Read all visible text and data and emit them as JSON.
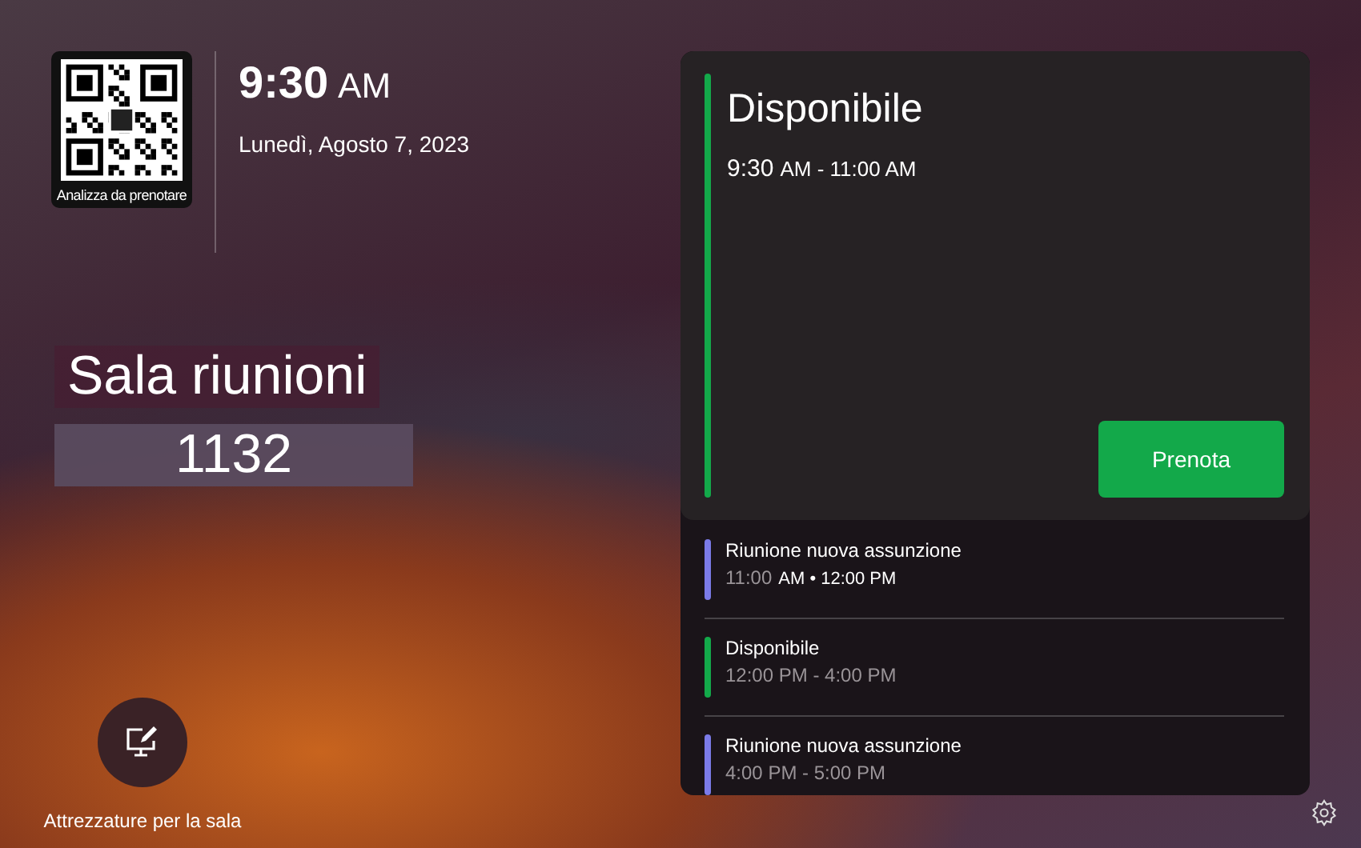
{
  "qr": {
    "caption": "Analizza da prenotare"
  },
  "clock": {
    "time": "9:30",
    "meridiem": "AM",
    "date": "Lunedì, Agosto 7, 2023"
  },
  "room": {
    "label": "Sala riunioni",
    "number": "1132"
  },
  "equipment": {
    "label": "Attrezzature per la sala"
  },
  "status": {
    "title": "Disponibile",
    "time": "9:30",
    "range": "AM - 11:00 AM",
    "color": "#13a94a",
    "button": "Prenota"
  },
  "agenda": [
    {
      "title": "Riunione nuova assunzione",
      "time": "11:00",
      "time_rest": "AM • 12:00 PM",
      "color": "#7b7be8"
    },
    {
      "title": "Disponibile",
      "time": "12:00 PM - 4:00 PM",
      "color": "#13a94a"
    },
    {
      "title": "Riunione nuova assunzione",
      "time": "4:00 PM - 5:00 PM",
      "color": "#7b7be8"
    }
  ]
}
